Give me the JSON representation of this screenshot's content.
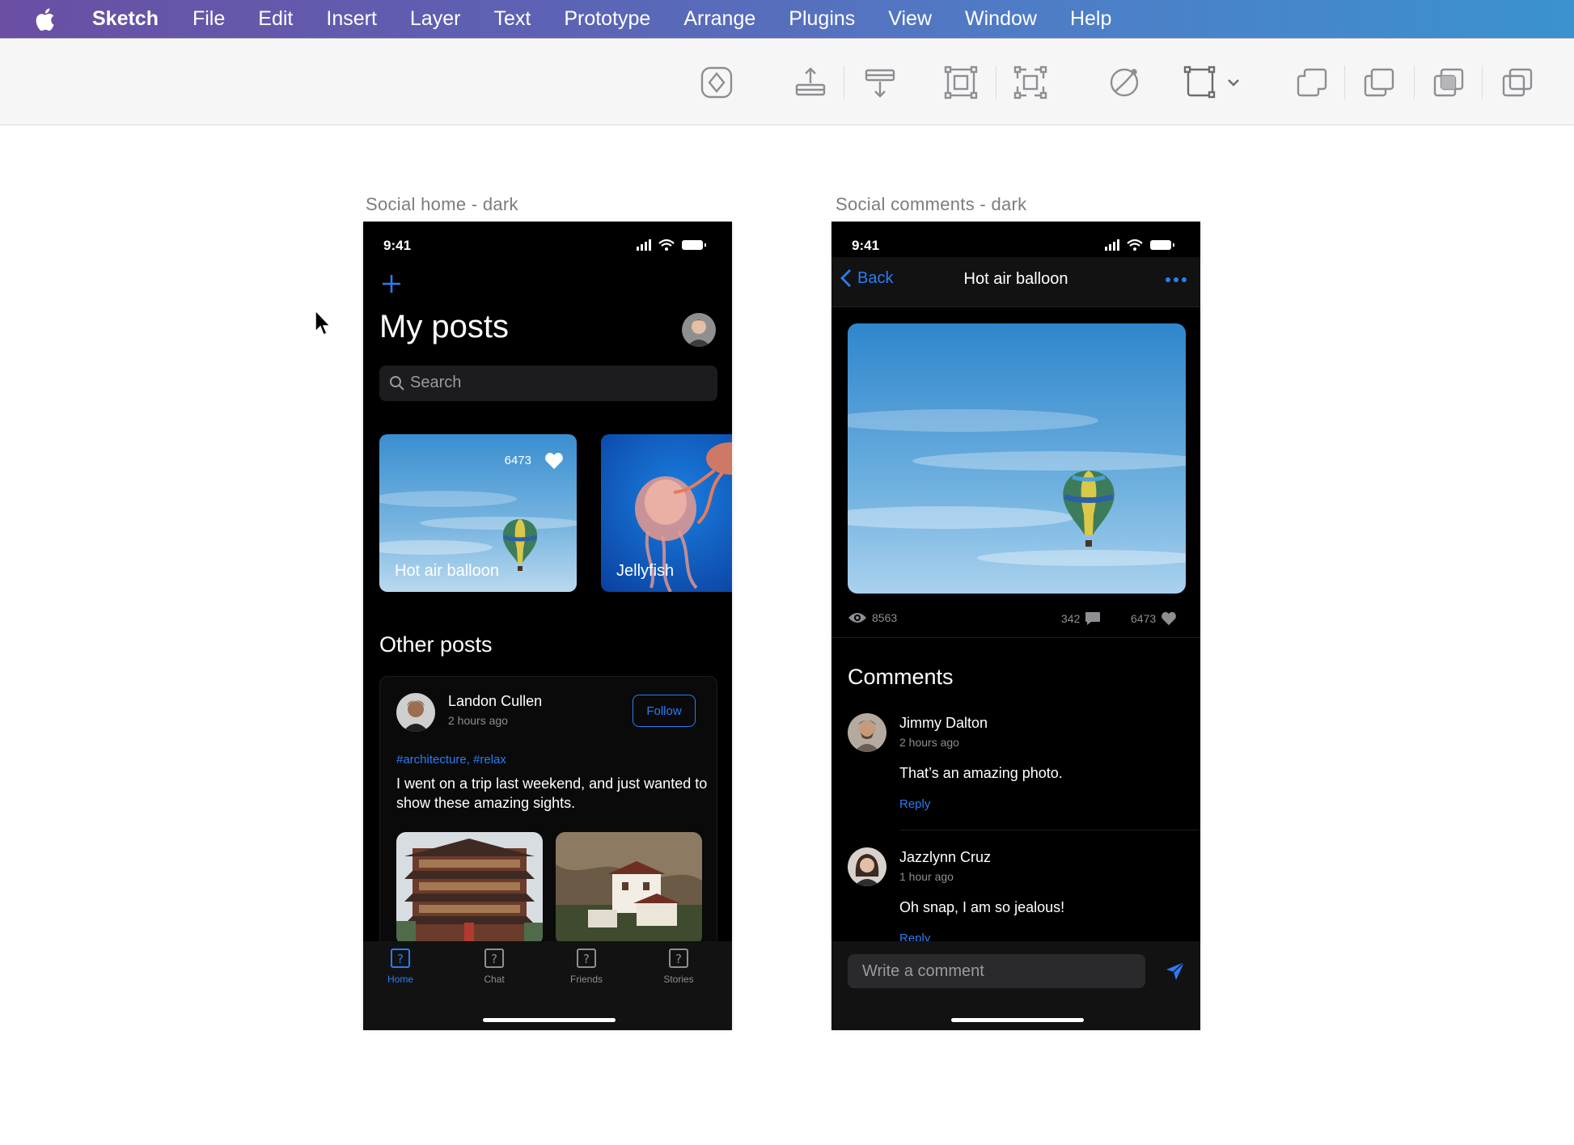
{
  "menubar": {
    "app_name": "Sketch",
    "items": [
      "File",
      "Edit",
      "Insert",
      "Layer",
      "Text",
      "Prototype",
      "Arrange",
      "Plugins",
      "View",
      "Window",
      "Help"
    ]
  },
  "toolbar": {
    "tools": [
      "create-symbol-icon",
      "forward-icon",
      "backward-icon",
      "group-icon",
      "ungroup-icon",
      "edit-path-icon",
      "transform-icon",
      "union-icon",
      "subtract-icon",
      "intersect-icon",
      "difference-icon"
    ]
  },
  "artboards": {
    "home_label": "Social home - dark",
    "comments_label": "Social comments - dark"
  },
  "home": {
    "time": "9:41",
    "title": "My posts",
    "search_placeholder": "Search",
    "cards": [
      {
        "title": "Hot air balloon",
        "likes": "6473"
      },
      {
        "title": "Jellyfish"
      }
    ],
    "other_posts": "Other posts",
    "post": {
      "author": "Landon Cullen",
      "time": "2 hours ago",
      "follow": "Follow",
      "tags": "#architecture, #relax",
      "body": "I went on a trip last weekend, and just wanted to show these amazing sights."
    },
    "tabs": [
      "Home",
      "Chat",
      "Friends",
      "Stories"
    ]
  },
  "comments": {
    "time": "9:41",
    "back": "Back",
    "title": "Hot air balloon",
    "views": "8563",
    "comment_count": "342",
    "likes": "6473",
    "heading": "Comments",
    "list": [
      {
        "name": "Jimmy Dalton",
        "time": "2 hours ago",
        "text": "That’s an amazing photo.",
        "reply": "Reply"
      },
      {
        "name": "Jazzlynn Cruz",
        "time": "1 hour ago",
        "text": "Oh snap, I am so jealous!",
        "reply": "Reply"
      }
    ],
    "input_placeholder": "Write a comment"
  }
}
